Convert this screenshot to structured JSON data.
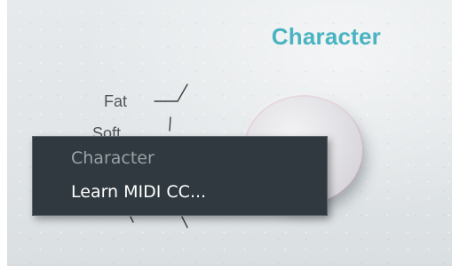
{
  "section": {
    "title": "Character",
    "title_color": "#49b3c2"
  },
  "scale": {
    "label_top": "Fat",
    "label_second": "Soft"
  },
  "context_menu": {
    "items": [
      {
        "label": "Character",
        "enabled": false
      },
      {
        "label": "Learn MIDI CC...",
        "enabled": true
      }
    ]
  },
  "colors": {
    "panel": "#e3e7e9",
    "menu_background": "#2f393f",
    "menu_text": "#ffffff",
    "menu_disabled_text": "#9aa2a6",
    "label_text": "#4f5559"
  }
}
